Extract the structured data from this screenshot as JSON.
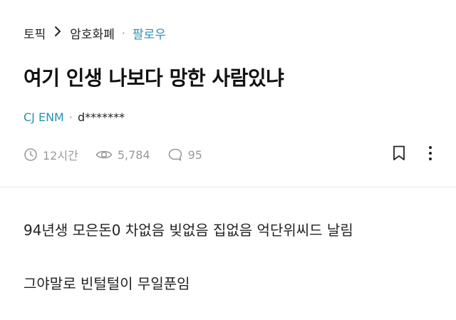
{
  "breadcrumb": {
    "root": "토픽",
    "channel": "암호화폐",
    "follow_label": "팔로우"
  },
  "post": {
    "title": "여기 인생 나보다 망한 사람있냐",
    "company": "CJ ENM",
    "author": "d*******",
    "time": "12시간",
    "views": "5,784",
    "comments": "95",
    "body": [
      "94년생 모은돈0 차없음 빚없음 집없음 억단위씨드 날림",
      "그야말로 빈털털이 무일푼임"
    ]
  },
  "icons": {
    "time": "clock-icon",
    "views": "eye-icon",
    "comments": "comment-icon",
    "bookmark": "bookmark-icon",
    "more": "more-vertical-icon"
  },
  "colors": {
    "accent": "#2a8fb6",
    "muted": "#999999",
    "text": "#222222"
  }
}
